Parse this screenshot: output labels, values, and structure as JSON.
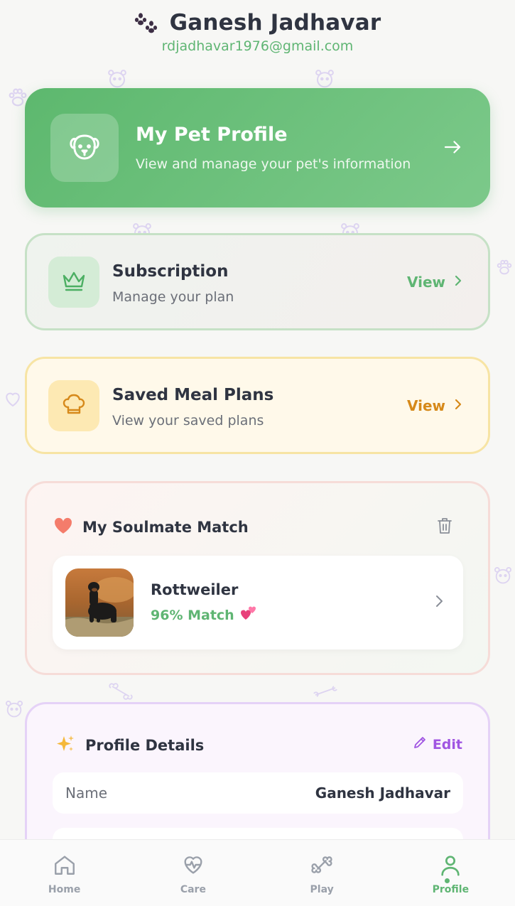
{
  "header": {
    "name": "Ganesh Jadhavar",
    "email": "rdjadhavar1976@gmail.com"
  },
  "pet_profile": {
    "title": "My Pet Profile",
    "subtitle": "View and manage your pet's information",
    "icon": "dog-face-icon"
  },
  "subscription": {
    "title": "Subscription",
    "subtitle": "Manage your plan",
    "action": "View",
    "icon": "crown-icon"
  },
  "meal_plans": {
    "title": "Saved Meal Plans",
    "subtitle": "View your saved plans",
    "action": "View",
    "icon": "chef-hat-icon"
  },
  "soulmate": {
    "title": "My Soulmate Match",
    "match_name": "Rottweiler",
    "match_percent": "96% Match"
  },
  "profile_details": {
    "title": "Profile Details",
    "edit_label": "Edit",
    "rows": [
      {
        "label": "Name",
        "value": "Ganesh Jadhavar"
      }
    ]
  },
  "nav": {
    "items": [
      {
        "label": "Home",
        "icon": "home-icon"
      },
      {
        "label": "Care",
        "icon": "heart-pulse-icon"
      },
      {
        "label": "Play",
        "icon": "bone-icon"
      },
      {
        "label": "Profile",
        "icon": "user-icon"
      }
    ],
    "active": "Profile"
  },
  "colors": {
    "brand_green": "#5fb573",
    "meal_orange": "#d6891a",
    "edit_purple": "#a055e2",
    "text_dark": "#2f3441"
  }
}
